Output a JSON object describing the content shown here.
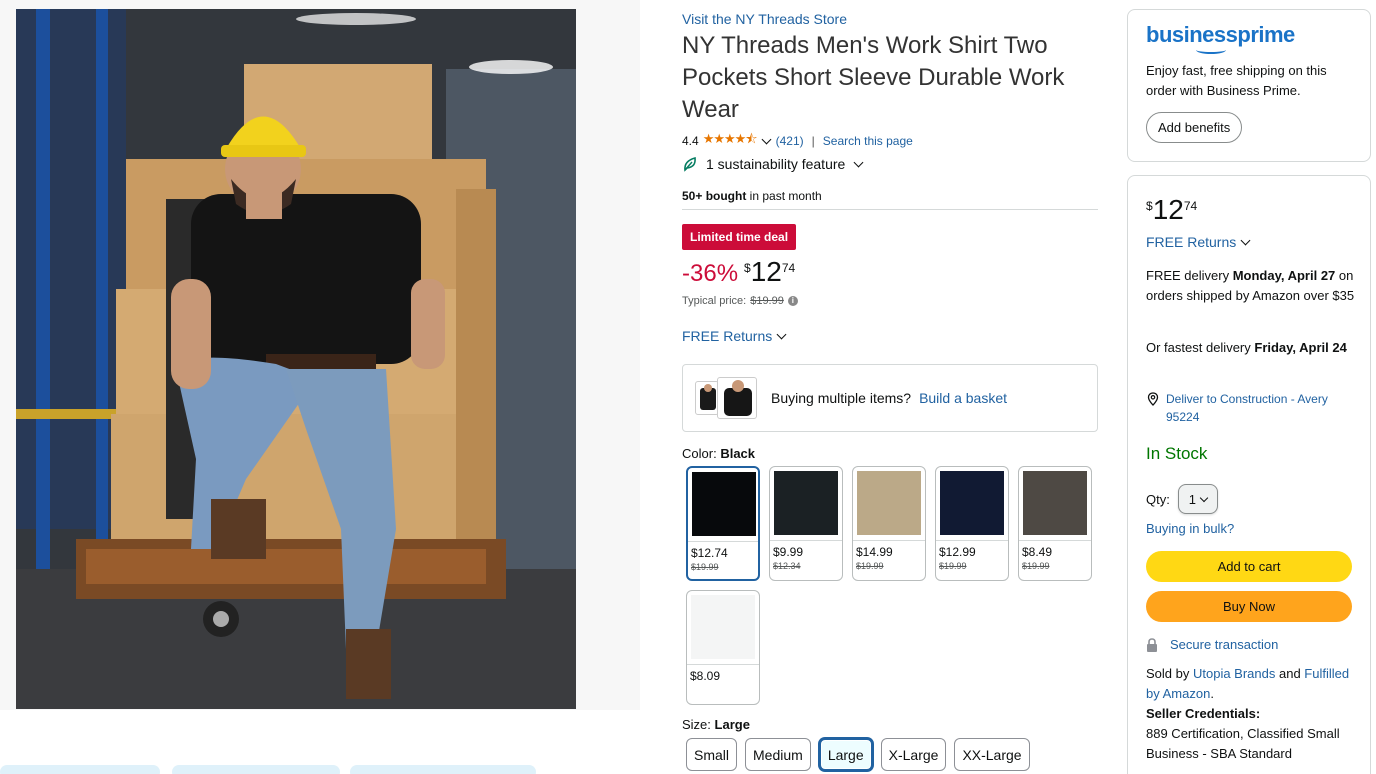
{
  "store_link": "Visit the NY Threads Store",
  "title": "NY Threads Men's Work Shirt Two Pockets Short Sleeve Durable Work Wear",
  "rating": {
    "value": "4.4",
    "stars": "★★★★⯪",
    "stars_value": 4.4,
    "count": "(421)",
    "separator": "|",
    "search_link": "Search this page"
  },
  "sustainability": "1 sustainability feature",
  "bought": {
    "bold": "50+ bought",
    "rest": " in past month"
  },
  "deal_badge": "Limited time deal",
  "price": {
    "discount": "-36%",
    "symbol": "$",
    "whole": "12",
    "fraction": "74",
    "typical_label": "Typical price:",
    "typical_value": "$19.99"
  },
  "free_returns": "FREE Returns",
  "basket": {
    "text": "Buying multiple items?",
    "link": "Build a basket"
  },
  "color": {
    "label": "Color:",
    "selected": "Black",
    "options": [
      {
        "name": "Black",
        "price": "$12.74",
        "old": "$19.99",
        "hex": "#07090c"
      },
      {
        "name": "Dark Navy Black",
        "price": "$9.99",
        "old": "$12.34",
        "hex": "#1b2124"
      },
      {
        "name": "Khaki",
        "price": "$14.99",
        "old": "$19.99",
        "hex": "#bba988"
      },
      {
        "name": "Navy",
        "price": "$12.99",
        "old": "$19.99",
        "hex": "#111a33"
      },
      {
        "name": "Grey",
        "price": "$8.49",
        "old": "$19.99",
        "hex": "#4e4944"
      },
      {
        "name": "White",
        "price": "$8.09",
        "old": "",
        "hex": "#f4f5f5"
      }
    ]
  },
  "size": {
    "label": "Size:",
    "selected": "Large",
    "options": [
      "Small",
      "Medium",
      "Large",
      "X-Large",
      "XX-Large"
    ]
  },
  "business_prime": {
    "logo_a": "business",
    "logo_b": "prime",
    "text": "Enjoy fast, free shipping on this order with Business Prime.",
    "button": "Add benefits"
  },
  "buy_box": {
    "price_symbol": "$",
    "price_whole": "12",
    "price_fraction": "74",
    "free_returns": "FREE Returns",
    "delivery_prefix": "FREE delivery ",
    "delivery_date": "Monday, April 27",
    "delivery_suffix": " on orders shipped by Amazon over $35",
    "fastest_prefix": "Or fastest delivery ",
    "fastest_date": "Friday, April 24",
    "deliver_to": "Deliver to Construction - Avery 95224",
    "stock": "In Stock",
    "qty_label": "Qty:",
    "qty_value": "1",
    "bulk_link": "Buying in bulk?",
    "add_to_cart": "Add to cart",
    "buy_now": "Buy Now",
    "secure": "Secure transaction",
    "sold_by_prefix": "Sold by ",
    "sold_by": "Utopia Brands",
    "sold_and": " and ",
    "fulfilled": "Fulfilled by Amazon",
    "fulfilled_end": ".",
    "cred_title": "Seller Credentials:",
    "cred_text": "889 Certification,  Classified Small Business - SBA Standard"
  },
  "colors": {
    "link": "#2162a1",
    "deal": "#cc0c39",
    "stock": "#007600",
    "cart": "#ffd814",
    "buy": "#ffa41c",
    "selected_border": "#2162a1"
  }
}
